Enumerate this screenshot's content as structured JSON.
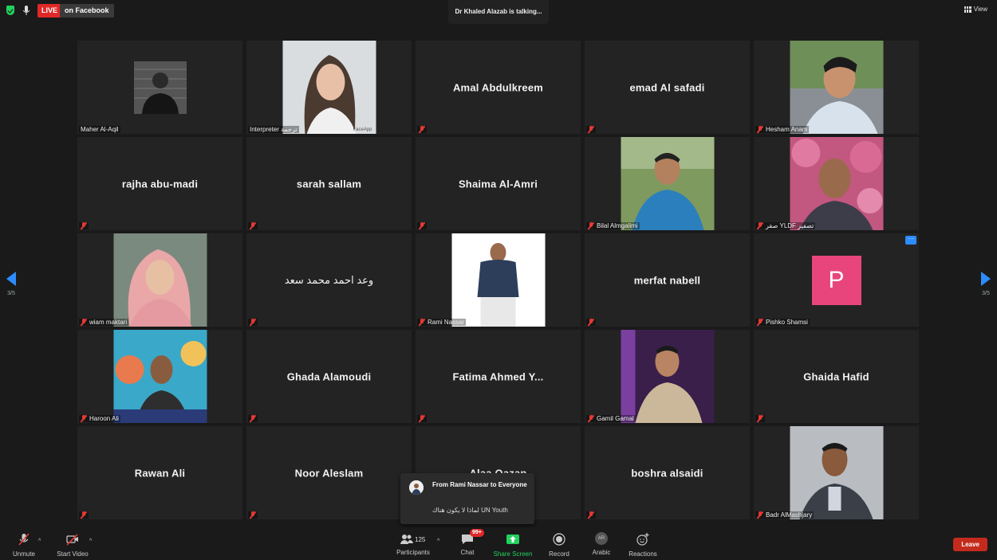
{
  "topbar": {
    "live": "LIVE",
    "live_destination": "on Facebook",
    "talking": "Dr Khaled Alazab is talking...",
    "view": "View"
  },
  "nav": {
    "left_page": "3/5",
    "right_page": "3/5"
  },
  "tiles": [
    {
      "name": "Maher Al-Aqil",
      "type": "photo-small"
    },
    {
      "name": "Interpreter ترجمة",
      "type": "photo",
      "watermark": "FaceApp"
    },
    {
      "name": "Amal Abdulkreem",
      "type": "name"
    },
    {
      "name": "emad Al safadi",
      "type": "name"
    },
    {
      "name": "Hesham Anam",
      "type": "photo"
    },
    {
      "name": "rajha abu-madi",
      "type": "name"
    },
    {
      "name": "sarah sallam",
      "type": "name"
    },
    {
      "name": "Shaima Al-Amri",
      "type": "name"
    },
    {
      "name": "Bilal Almgalimi",
      "type": "photo"
    },
    {
      "name": "صقر YLDF تصفير",
      "type": "photo"
    },
    {
      "name": "wiam maktari",
      "type": "photo"
    },
    {
      "name": "وعد احمد محمد سعد",
      "type": "name"
    },
    {
      "name": "Rami Nassar",
      "type": "photo"
    },
    {
      "name": "merfat nabell",
      "type": "name"
    },
    {
      "name": "Pishko Shamsi",
      "type": "avatar",
      "initial": "P"
    },
    {
      "name": "Haroon Ali",
      "type": "photo"
    },
    {
      "name": "Ghada Alamoudi",
      "type": "name"
    },
    {
      "name": "Fatima Ahmed Y...",
      "type": "name"
    },
    {
      "name": "Gamil Gamal",
      "type": "photo"
    },
    {
      "name": "Ghaida Hafid",
      "type": "name"
    },
    {
      "name": "Rawan Ali",
      "type": "name"
    },
    {
      "name": "Noor Aleslam",
      "type": "name"
    },
    {
      "name": "Alaa Qazan",
      "type": "name"
    },
    {
      "name": "boshra alsaidi",
      "type": "name"
    },
    {
      "name": "Badr AlMashjary",
      "type": "photo"
    }
  ],
  "chat_popup": {
    "from": "From Rami Nassar to Everyone",
    "message": "لماذا لا يكون هناك UN Youth"
  },
  "toolbar": {
    "unmute": "Unmute",
    "start_video": "Start Video",
    "participants": "Participants",
    "participant_count": "125",
    "chat": "Chat",
    "chat_badge": "99+",
    "share_screen": "Share Screen",
    "record": "Record",
    "language": "Arabic",
    "language_initials": "AR",
    "reactions": "Reactions",
    "leave": "Leave"
  },
  "colors": {
    "accent": "#2d8cff",
    "live": "#e02828",
    "share_green": "#23d160",
    "avatar_pink": "#e8457c",
    "leave_red": "#c42b1c"
  }
}
